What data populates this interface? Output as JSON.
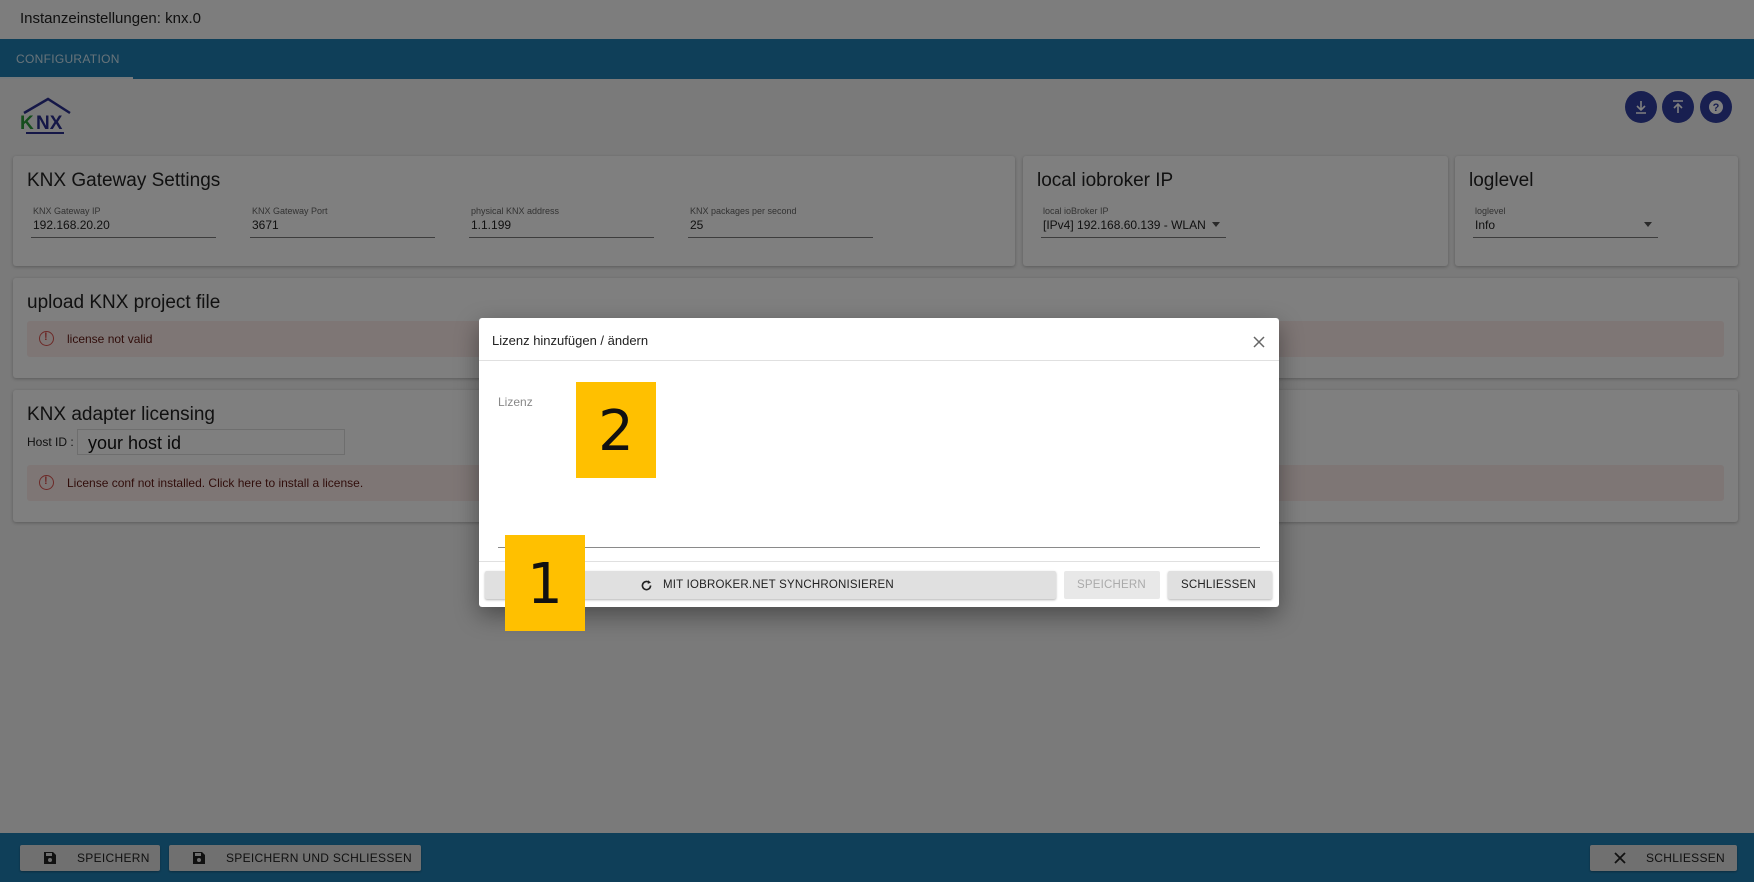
{
  "window": {
    "title": "Instanzeinstellungen: knx.0"
  },
  "tabs": [
    {
      "label": "CONFIGURATION",
      "active": true
    }
  ],
  "logo": {
    "text": "KNX"
  },
  "toolbar": {
    "icons": [
      "download-icon",
      "upload-icon",
      "help-icon"
    ]
  },
  "gateway_card": {
    "title": "KNX Gateway Settings",
    "fields": [
      {
        "label": "KNX Gateway IP",
        "value": "192.168.20.20"
      },
      {
        "label": "KNX Gateway Port",
        "value": "3671"
      },
      {
        "label": "physical KNX address",
        "value": "1.1.199"
      },
      {
        "label": "KNX packages per second",
        "value": "25"
      }
    ]
  },
  "local_ip_card": {
    "title": "local iobroker IP",
    "field": {
      "label": "local ioBroker IP",
      "value": "[IPv4] 192.168.60.139 - WLAN"
    }
  },
  "loglevel_card": {
    "title": "loglevel",
    "field": {
      "label": "loglevel",
      "value": "Info"
    }
  },
  "upload_card": {
    "title": "upload KNX project file",
    "alert": "license not valid"
  },
  "licensing_card": {
    "title": "KNX adapter licensing",
    "host_id_label": "Host ID :",
    "host_id_value": "your  host id",
    "alert": "License conf not installed. Click here to install a license."
  },
  "dialog": {
    "title": "Lizenz hinzufügen / ändern",
    "license_label": "Lizenz",
    "sync_button": "MIT IOBROKER.NET SYNCHRONISIEREN",
    "save_button": "SPEICHERN",
    "close_button": "SCHLIESSEN"
  },
  "markers": {
    "one": "1",
    "two": "2"
  },
  "bottom_bar": {
    "save": "SPEICHERN",
    "save_close": "SPEICHERN UND SCHLIESSEN",
    "close": "SCHLIESSEN"
  },
  "colors": {
    "primary": "#1f7fb3",
    "fab": "#303fa0",
    "marker": "#ffc000",
    "alert_bg": "#fdecea",
    "alert_icon": "#d9534f"
  }
}
